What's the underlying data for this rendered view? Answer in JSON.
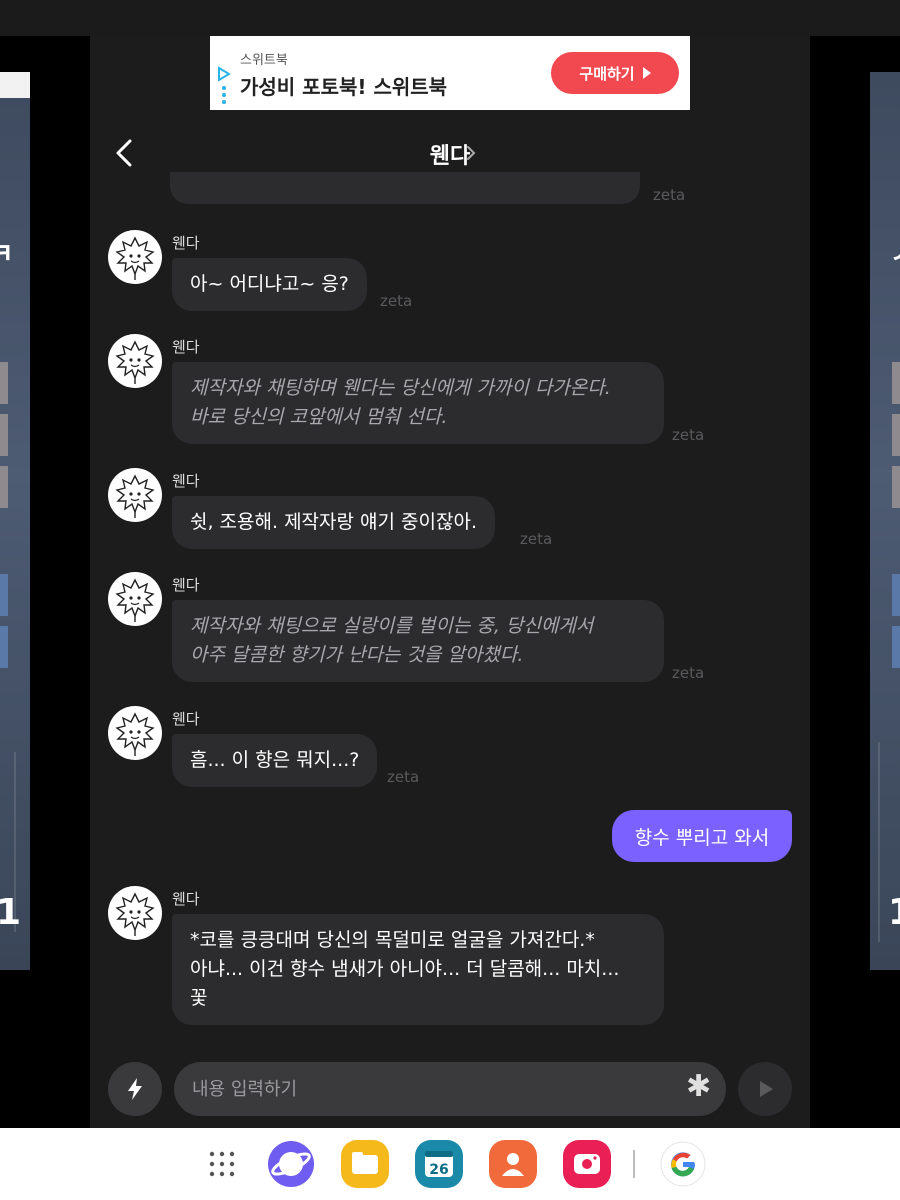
{
  "ad": {
    "brand": "스위트북",
    "title": "가성비 포토북! 스위트북",
    "button_label": "구매하기"
  },
  "header": {
    "character_name": "웬다"
  },
  "side": {
    "left_big": "1",
    "right_big": "1",
    "left_partial": "ㅋ",
    "right_partial": "ㅅ"
  },
  "chat": {
    "watermark": "zeta",
    "messages": [
      {
        "sender": "웬다",
        "type": "speech",
        "text": "아~ 어디냐고~ 응?"
      },
      {
        "sender": "웬다",
        "type": "action",
        "text": "제작자와 채팅하며 웬다는 당신에게 가까이 다가온다.\n바로 당신의 코앞에서 멈춰 선다."
      },
      {
        "sender": "웬다",
        "type": "speech",
        "text": "쉿, 조용해. 제작자랑 얘기 중이잖아."
      },
      {
        "sender": "웬다",
        "type": "action",
        "text": "제작자와 채팅으로 실랑이를 벌이는 중, 당신에게서\n아주 달콤한 향기가 난다는 것을 알아챘다."
      },
      {
        "sender": "웬다",
        "type": "speech",
        "text": "흠... 이 향은 뭐지...?"
      },
      {
        "sender": "웬다",
        "type": "speech",
        "text": "*코를 킁킁대며 당신의 목덜미로 얼굴을 가져간다.*\n아냐... 이건 향수 냄새가 아니야... 더 달콤해... 마치...\n꽃"
      }
    ],
    "user_message": "향수 뿌리고 와서"
  },
  "input": {
    "placeholder": "내용 입력하기"
  },
  "taskbar": {
    "apps": [
      "app-drawer",
      "samsung-internet",
      "my-files",
      "calendar",
      "contacts",
      "screen-recorder",
      "google"
    ],
    "calendar_day": "26"
  },
  "colors": {
    "background": "#1c1c1d",
    "bubble": "#2c2c2e",
    "user_bubble": "#7b61ff",
    "ad_button": "#f2484f"
  }
}
